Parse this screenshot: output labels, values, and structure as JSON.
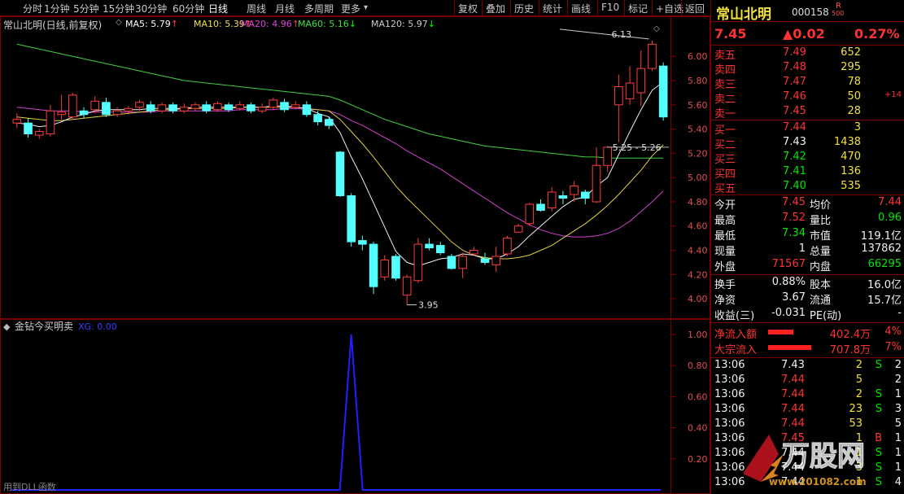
{
  "toolbar": {
    "periods": [
      "分时",
      "1分钟",
      "5分钟",
      "15分钟",
      "30分钟",
      "60分钟",
      "日线",
      "周线",
      "月线",
      "多周期",
      "更多"
    ],
    "active_period": "日线",
    "more_arrow": "▾",
    "actions": [
      "复权",
      "叠加",
      "历史",
      "统计",
      "画线",
      "F10",
      "标记",
      "+自选",
      "返回"
    ]
  },
  "chart": {
    "title": "常山北明(日线,前复权)",
    "ma": [
      {
        "label": "MA5: 5.79",
        "arrow": "↑",
        "color": "#ffffff"
      },
      {
        "label": "MA10: 5.39",
        "arrow": "↑",
        "color": "#f0e040"
      },
      {
        "label": "MA20: 4.96",
        "arrow": "↑",
        "color": "#e040e0"
      },
      {
        "label": "MA60: 5.16",
        "arrow": "↓",
        "color": "#40e040"
      },
      {
        "label": "MA120: 5.97",
        "arrow": "↓",
        "color": "#cccccc"
      }
    ],
    "price_axis": [
      "6.00",
      "5.80",
      "5.60",
      "5.40",
      "5.20",
      "5.00",
      "4.80",
      "4.60",
      "4.40",
      "4.20",
      "4.00"
    ],
    "high_label": "6.13",
    "low_label": "3.95",
    "cross_label": "5.25 - 5.26"
  },
  "chart_data": {
    "type": "candlestick",
    "y_range": [
      3.9,
      6.25
    ],
    "candles": [
      {
        "o": 5.45,
        "c": 5.48,
        "h": 5.53,
        "l": 5.41
      },
      {
        "o": 5.45,
        "c": 5.36,
        "h": 5.49,
        "l": 5.33
      },
      {
        "o": 5.35,
        "c": 5.38,
        "h": 5.4,
        "l": 5.32
      },
      {
        "o": 5.36,
        "c": 5.55,
        "h": 5.6,
        "l": 5.34
      },
      {
        "o": 5.52,
        "c": 5.54,
        "h": 5.68,
        "l": 5.48
      },
      {
        "o": 5.5,
        "c": 5.68,
        "h": 5.7,
        "l": 5.48
      },
      {
        "o": 5.55,
        "c": 5.52,
        "h": 5.58,
        "l": 5.49
      },
      {
        "o": 5.56,
        "c": 5.63,
        "h": 5.67,
        "l": 5.53
      },
      {
        "o": 5.62,
        "c": 5.52,
        "h": 5.66,
        "l": 5.5
      },
      {
        "o": 5.52,
        "c": 5.55,
        "h": 5.58,
        "l": 5.5
      },
      {
        "o": 5.55,
        "c": 5.57,
        "h": 5.59,
        "l": 5.52
      },
      {
        "o": 5.58,
        "c": 5.62,
        "h": 5.64,
        "l": 5.55
      },
      {
        "o": 5.6,
        "c": 5.55,
        "h": 5.63,
        "l": 5.53
      },
      {
        "o": 5.55,
        "c": 5.6,
        "h": 5.62,
        "l": 5.53
      },
      {
        "o": 5.6,
        "c": 5.55,
        "h": 5.62,
        "l": 5.53
      },
      {
        "o": 5.55,
        "c": 5.58,
        "h": 5.61,
        "l": 5.53
      },
      {
        "o": 5.57,
        "c": 5.6,
        "h": 5.62,
        "l": 5.55
      },
      {
        "o": 5.6,
        "c": 5.55,
        "h": 5.63,
        "l": 5.53
      },
      {
        "o": 5.56,
        "c": 5.61,
        "h": 5.63,
        "l": 5.54
      },
      {
        "o": 5.6,
        "c": 5.56,
        "h": 5.62,
        "l": 5.54
      },
      {
        "o": 5.57,
        "c": 5.6,
        "h": 5.63,
        "l": 5.55
      },
      {
        "o": 5.6,
        "c": 5.55,
        "h": 5.62,
        "l": 5.53
      },
      {
        "o": 5.55,
        "c": 5.58,
        "h": 5.61,
        "l": 5.53
      },
      {
        "o": 5.58,
        "c": 5.64,
        "h": 5.66,
        "l": 5.56
      },
      {
        "o": 5.62,
        "c": 5.56,
        "h": 5.65,
        "l": 5.54
      },
      {
        "o": 5.58,
        "c": 5.6,
        "h": 5.63,
        "l": 5.56
      },
      {
        "o": 5.6,
        "c": 5.52,
        "h": 5.63,
        "l": 5.5
      },
      {
        "o": 5.52,
        "c": 5.46,
        "h": 5.55,
        "l": 5.43
      },
      {
        "o": 5.48,
        "c": 5.43,
        "h": 5.5,
        "l": 5.4
      },
      {
        "o": 5.21,
        "c": 4.85,
        "h": 5.22,
        "l": 4.84
      },
      {
        "o": 4.85,
        "c": 4.47,
        "h": 4.87,
        "l": 4.43
      },
      {
        "o": 4.48,
        "c": 4.45,
        "h": 4.52,
        "l": 4.4
      },
      {
        "o": 4.45,
        "c": 4.1,
        "h": 4.47,
        "l": 4.04
      },
      {
        "o": 4.18,
        "c": 4.32,
        "h": 4.36,
        "l": 4.15
      },
      {
        "o": 4.35,
        "c": 4.17,
        "h": 4.37,
        "l": 4.15
      },
      {
        "o": 4.03,
        "c": 4.18,
        "h": 4.2,
        "l": 3.95
      },
      {
        "o": 4.15,
        "c": 4.45,
        "h": 4.5,
        "l": 4.13
      },
      {
        "o": 4.45,
        "c": 4.42,
        "h": 4.5,
        "l": 4.4
      },
      {
        "o": 4.44,
        "c": 4.38,
        "h": 4.47,
        "l": 4.36
      },
      {
        "o": 4.35,
        "c": 4.25,
        "h": 4.37,
        "l": 4.24
      },
      {
        "o": 4.25,
        "c": 4.35,
        "h": 4.38,
        "l": 4.17
      },
      {
        "o": 4.37,
        "c": 4.4,
        "h": 4.43,
        "l": 4.36
      },
      {
        "o": 4.33,
        "c": 4.3,
        "h": 4.38,
        "l": 4.28
      },
      {
        "o": 4.28,
        "c": 4.35,
        "h": 4.43,
        "l": 4.22
      },
      {
        "o": 4.37,
        "c": 4.5,
        "h": 4.52,
        "l": 4.35
      },
      {
        "o": 4.55,
        "c": 4.6,
        "h": 4.62,
        "l": 4.55
      },
      {
        "o": 4.62,
        "c": 4.78,
        "h": 4.79,
        "l": 4.6
      },
      {
        "o": 4.78,
        "c": 4.73,
        "h": 4.82,
        "l": 4.72
      },
      {
        "o": 4.75,
        "c": 4.88,
        "h": 4.92,
        "l": 4.72
      },
      {
        "o": 4.85,
        "c": 4.83,
        "h": 4.89,
        "l": 4.78
      },
      {
        "o": 4.86,
        "c": 4.93,
        "h": 4.97,
        "l": 4.8
      },
      {
        "o": 4.88,
        "c": 4.83,
        "h": 4.9,
        "l": 4.78
      },
      {
        "o": 4.8,
        "c": 5.1,
        "h": 5.25,
        "l": 4.79
      },
      {
        "o": 5.1,
        "c": 5.25,
        "h": 5.26,
        "l": 5.05
      },
      {
        "o": 5.6,
        "c": 5.75,
        "h": 5.85,
        "l": 5.29
      },
      {
        "o": 5.65,
        "c": 5.78,
        "h": 5.92,
        "l": 5.6
      },
      {
        "o": 5.7,
        "c": 5.9,
        "h": 6.05,
        "l": 5.59
      },
      {
        "o": 5.9,
        "c": 6.1,
        "h": 6.13,
        "l": 5.88
      },
      {
        "o": 5.92,
        "c": 5.5,
        "h": 5.95,
        "l": 5.47
      }
    ],
    "ma5": [
      5.45,
      5.44,
      5.42,
      5.43,
      5.46,
      5.5,
      5.52,
      5.55,
      5.56,
      5.56,
      5.56,
      5.56,
      5.57,
      5.57,
      5.57,
      5.57,
      5.58,
      5.58,
      5.58,
      5.58,
      5.58,
      5.58,
      5.58,
      5.59,
      5.59,
      5.58,
      5.57,
      5.53,
      5.5,
      5.37,
      5.17,
      4.99,
      4.79,
      4.59,
      4.39,
      4.3,
      4.27,
      4.3,
      4.33,
      4.34,
      4.37,
      4.36,
      4.33,
      4.33,
      4.37,
      4.43,
      4.52,
      4.6,
      4.68,
      4.76,
      4.82,
      4.84,
      4.93,
      5.0,
      5.19,
      5.38,
      5.56,
      5.72,
      5.79
    ],
    "ma10": [
      5.5,
      5.49,
      5.48,
      5.47,
      5.47,
      5.48,
      5.49,
      5.5,
      5.51,
      5.52,
      5.53,
      5.54,
      5.55,
      5.56,
      5.56,
      5.57,
      5.57,
      5.57,
      5.57,
      5.57,
      5.58,
      5.58,
      5.58,
      5.58,
      5.58,
      5.58,
      5.57,
      5.56,
      5.55,
      5.48,
      5.38,
      5.28,
      5.17,
      5.05,
      4.93,
      4.83,
      4.74,
      4.65,
      4.56,
      4.47,
      4.4,
      4.36,
      4.34,
      4.33,
      4.33,
      4.34,
      4.36,
      4.4,
      4.44,
      4.5,
      4.56,
      4.62,
      4.69,
      4.77,
      4.86,
      4.96,
      5.06,
      5.18,
      5.27
    ],
    "ma20": [
      5.58,
      5.57,
      5.56,
      5.55,
      5.55,
      5.55,
      5.54,
      5.54,
      5.54,
      5.54,
      5.54,
      5.54,
      5.54,
      5.55,
      5.55,
      5.55,
      5.55,
      5.55,
      5.55,
      5.55,
      5.56,
      5.56,
      5.56,
      5.56,
      5.57,
      5.57,
      5.56,
      5.56,
      5.55,
      5.52,
      5.47,
      5.43,
      5.38,
      5.33,
      5.28,
      5.22,
      5.17,
      5.12,
      5.07,
      5.01,
      4.95,
      4.89,
      4.83,
      4.77,
      4.71,
      4.66,
      4.61,
      4.57,
      4.54,
      4.52,
      4.51,
      4.51,
      4.52,
      4.54,
      4.58,
      4.64,
      4.72,
      4.8,
      4.89
    ],
    "ma60": [
      6.1,
      6.08,
      6.06,
      6.04,
      6.02,
      6.0,
      5.98,
      5.96,
      5.94,
      5.92,
      5.9,
      5.88,
      5.86,
      5.84,
      5.82,
      5.8,
      5.79,
      5.78,
      5.77,
      5.76,
      5.75,
      5.74,
      5.73,
      5.72,
      5.71,
      5.7,
      5.69,
      5.68,
      5.67,
      5.64,
      5.6,
      5.56,
      5.52,
      5.48,
      5.45,
      5.42,
      5.39,
      5.36,
      5.34,
      5.32,
      5.3,
      5.28,
      5.26,
      5.25,
      5.24,
      5.23,
      5.22,
      5.21,
      5.2,
      5.19,
      5.18,
      5.17,
      5.17,
      5.16,
      5.16,
      5.16,
      5.16,
      5.16,
      5.16
    ],
    "indicator": {
      "max": 1.0,
      "spike_index": 30,
      "axis": [
        "1.00",
        "0.80",
        "0.60",
        "0.40",
        "0.20"
      ]
    }
  },
  "indicator": {
    "title": "金钻今买明卖",
    "xg_label": "XG: 0.00",
    "bottom_label": "用到DLL函数"
  },
  "quote": {
    "name": "常山北明",
    "code": "000158",
    "badge_top": "R",
    "badge_bottom": "500",
    "price": "7.45",
    "change": "▲0.02",
    "pct": "0.27%",
    "asks": [
      {
        "label": "卖五",
        "price": "7.49",
        "vol": "652",
        "chg": ""
      },
      {
        "label": "卖四",
        "price": "7.48",
        "vol": "295",
        "chg": ""
      },
      {
        "label": "卖三",
        "price": "7.47",
        "vol": "78",
        "chg": ""
      },
      {
        "label": "卖二",
        "price": "7.46",
        "vol": "50",
        "chg": "+14"
      },
      {
        "label": "卖一",
        "price": "7.45",
        "vol": "28",
        "chg": ""
      }
    ],
    "bids": [
      {
        "label": "买一",
        "price": "7.44",
        "vol": "3",
        "pcolor": "red"
      },
      {
        "label": "买二",
        "price": "7.43",
        "vol": "1438",
        "pcolor": "white"
      },
      {
        "label": "买三",
        "price": "7.42",
        "vol": "470",
        "pcolor": "green"
      },
      {
        "label": "买四",
        "price": "7.41",
        "vol": "136",
        "pcolor": "green"
      },
      {
        "label": "买五",
        "price": "7.40",
        "vol": "535",
        "pcolor": "green"
      }
    ],
    "stats": [
      {
        "l1": "今开",
        "v1": "7.45",
        "c1": "red",
        "l2": "均价",
        "v2": "7.44",
        "c2": "red"
      },
      {
        "l1": "最高",
        "v1": "7.52",
        "c1": "red",
        "l2": "量比",
        "v2": "0.96",
        "c2": "green"
      },
      {
        "l1": "最低",
        "v1": "7.34",
        "c1": "green",
        "l2": "市值",
        "v2": "119.1亿",
        "c2": "white"
      },
      {
        "l1": "现量",
        "v1": "1",
        "c1": "white",
        "l2": "总量",
        "v2": "137862",
        "c2": "white"
      },
      {
        "l1": "外盘",
        "v1": "71567",
        "c1": "red",
        "l2": "内盘",
        "v2": "66295",
        "c2": "green"
      }
    ],
    "stats2": [
      {
        "l1": "换手",
        "v1": "0.88%",
        "c1": "white",
        "l2": "股本",
        "v2": "16.0亿",
        "c2": "white"
      },
      {
        "l1": "净资",
        "v1": "3.67",
        "c1": "white",
        "l2": "流通",
        "v2": "15.7亿",
        "c2": "white"
      },
      {
        "l1": "收益(三)",
        "v1": "-0.031",
        "c1": "white",
        "l2": "PE(动)",
        "v2": "-",
        "c2": "white"
      }
    ],
    "flows": [
      {
        "label": "净流入额",
        "value": "402.4万",
        "pct": "4%",
        "bar": 0.55
      },
      {
        "label": "大宗流入",
        "value": "707.8万",
        "pct": "7%",
        "bar": 0.95
      }
    ],
    "ticks": [
      {
        "time": "13:06",
        "price": "7.43",
        "pcolor": "white",
        "vol": "2",
        "flag": "S",
        "n": "2"
      },
      {
        "time": "13:06",
        "price": "7.44",
        "pcolor": "red",
        "vol": "5",
        "flag": "",
        "n": "2"
      },
      {
        "time": "13:06",
        "price": "7.44",
        "pcolor": "red",
        "vol": "2",
        "flag": "S",
        "n": "1"
      },
      {
        "time": "13:06",
        "price": "7.44",
        "pcolor": "red",
        "vol": "23",
        "flag": "S",
        "n": "3"
      },
      {
        "time": "13:06",
        "price": "7.44",
        "pcolor": "red",
        "vol": "53",
        "flag": "",
        "n": "5"
      },
      {
        "time": "13:06",
        "price": "7.45",
        "pcolor": "red",
        "vol": "1",
        "flag": "B",
        "n": "1"
      },
      {
        "time": "13:06",
        "price": "7.44",
        "pcolor": "white",
        "vol": "1",
        "flag": "S",
        "n": "1"
      },
      {
        "time": "13:06",
        "price": "7.44",
        "pcolor": "white",
        "vol": "3",
        "flag": "S",
        "n": "1"
      },
      {
        "time": "13:06",
        "price": "7.44",
        "pcolor": "white",
        "vol": "1",
        "flag": "S",
        "n": "4"
      }
    ]
  },
  "colors": {
    "up": "#ff3c3c",
    "down": "#54ffff",
    "grid": "#7a0000",
    "ind": "#2020ff"
  },
  "watermark": {
    "text": "万股网",
    "url": "www.201082.com"
  }
}
